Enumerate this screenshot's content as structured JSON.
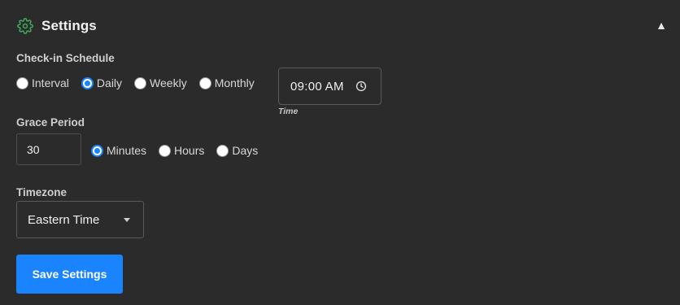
{
  "header": {
    "title": "Settings",
    "icon": "gear-icon",
    "collapse_glyph": "▲"
  },
  "schedule": {
    "label": "Check-in Schedule",
    "options": [
      "Interval",
      "Daily",
      "Weekly",
      "Monthly"
    ],
    "selected": "Daily"
  },
  "time": {
    "value": "09:00 AM",
    "caption": "Time",
    "icon": "clock-icon"
  },
  "grace": {
    "label": "Grace Period",
    "value": "30",
    "units": [
      "Minutes",
      "Hours",
      "Days"
    ],
    "selected": "Minutes"
  },
  "timezone": {
    "label": "Timezone",
    "value": "Eastern Time"
  },
  "save_button": {
    "label": "Save Settings"
  },
  "colors": {
    "accent": "#1a84ff",
    "icon_green": "#3fae5a",
    "background": "#2b2b2b"
  }
}
